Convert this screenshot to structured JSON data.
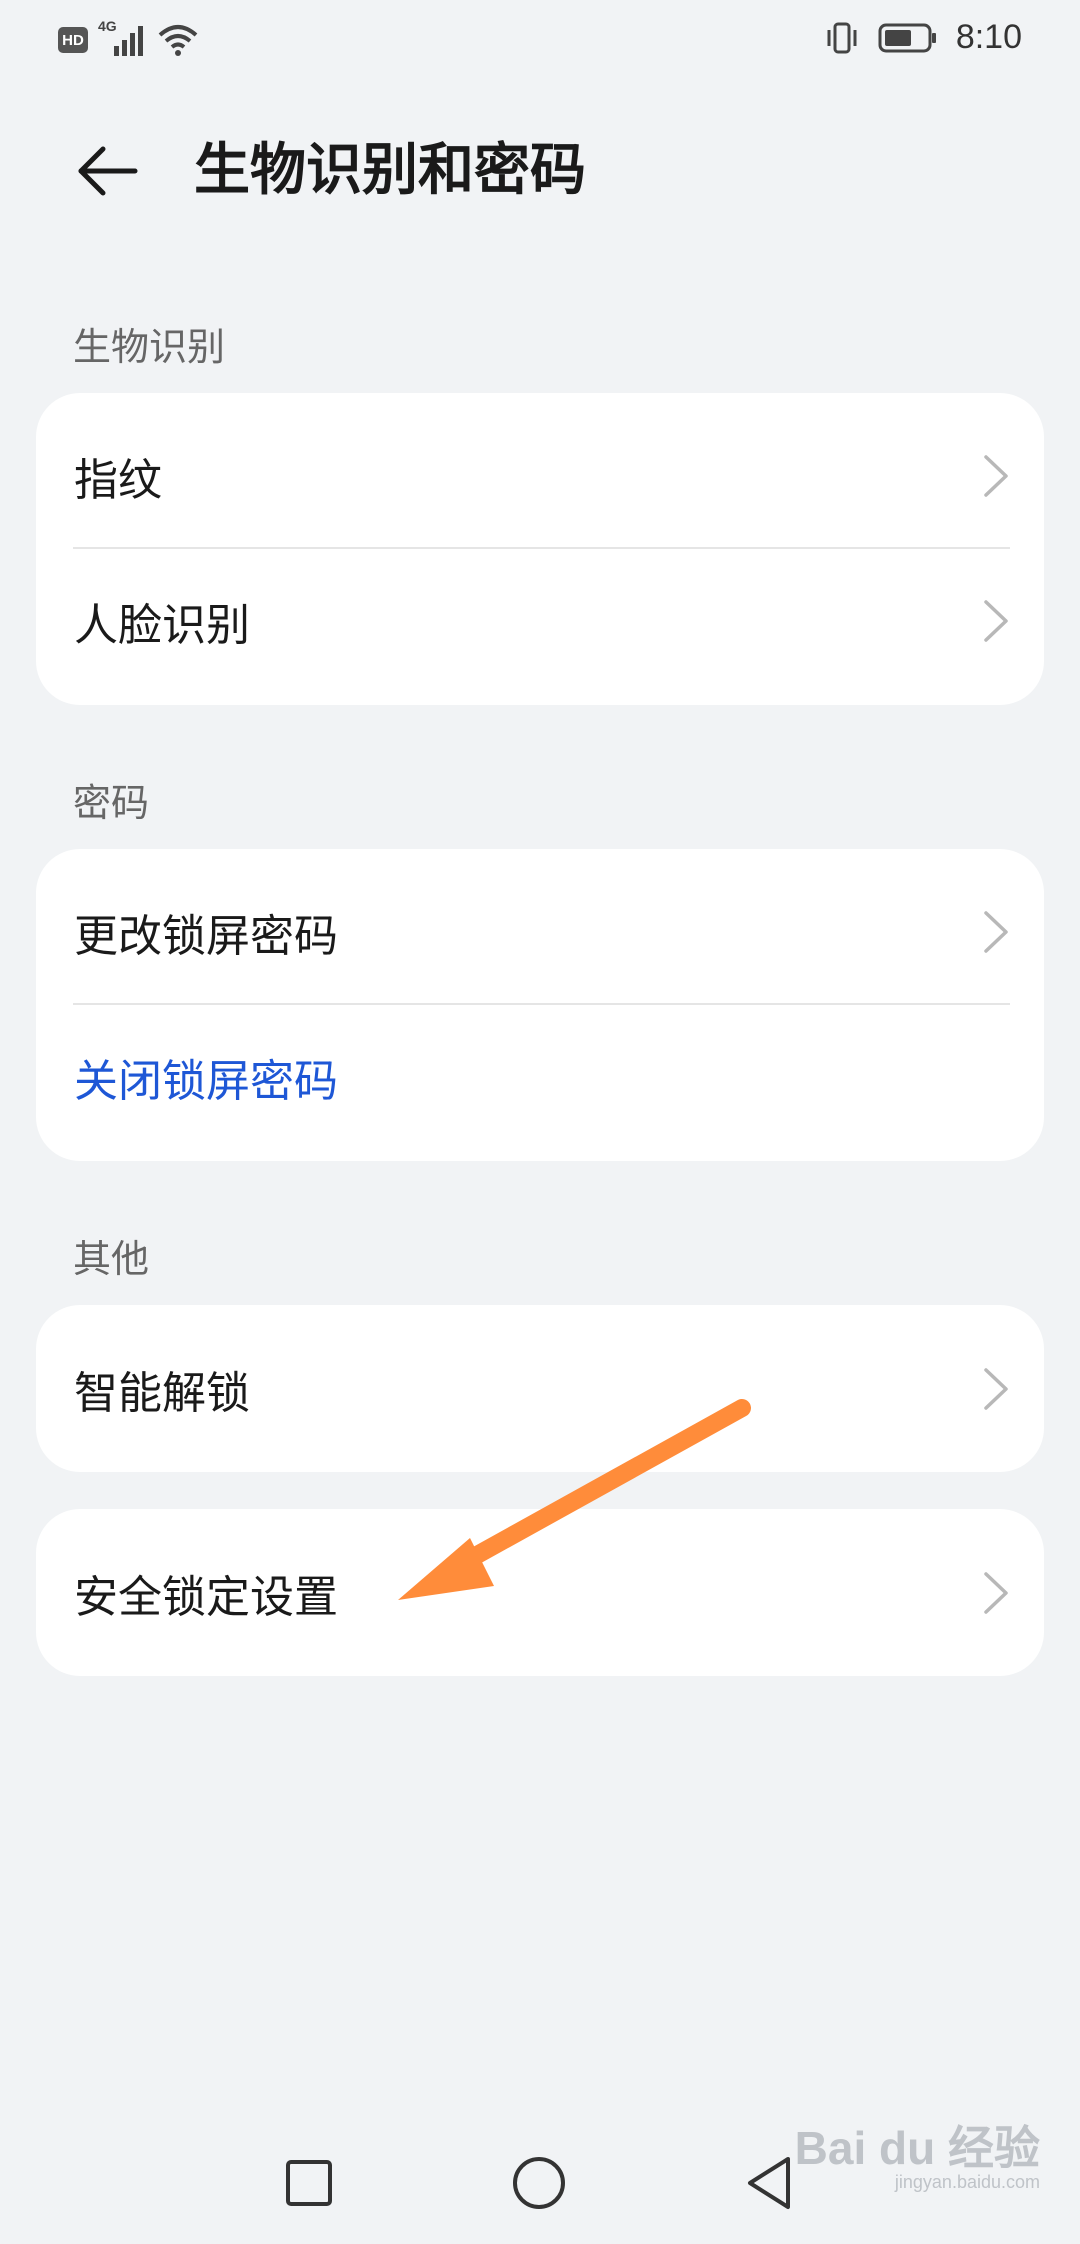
{
  "status_bar": {
    "hd": "HD",
    "network": "4G",
    "time": "8:10"
  },
  "header": {
    "title": "生物识别和密码",
    "back_icon": "arrow-left-icon"
  },
  "sections": [
    {
      "label": "生物识别",
      "items": [
        {
          "label": "指纹"
        },
        {
          "label": "人脸识别"
        }
      ]
    },
    {
      "label": "密码",
      "items": [
        {
          "label": "更改锁屏密码"
        },
        {
          "label": "关闭锁屏密码"
        }
      ]
    },
    {
      "label": "其他",
      "items": [
        {
          "label": "智能解锁"
        },
        {
          "label": "安全锁定设置"
        }
      ]
    }
  ],
  "colors": {
    "background": "#f1f3f5",
    "card": "#ffffff",
    "link_blue": "#1e57d6",
    "annotation_arrow": "#ff8c3a"
  },
  "watermark": {
    "main": "Bai du 经验",
    "sub": "jingyan.baidu.com"
  }
}
